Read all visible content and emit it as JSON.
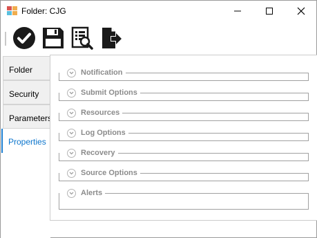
{
  "window": {
    "title": "Folder: CJG",
    "controls": [
      "minimize-icon",
      "maximize-icon",
      "close-icon"
    ]
  },
  "toolbar": {
    "buttons": [
      {
        "name": "ok",
        "icon": "check-circle-icon"
      },
      {
        "name": "save",
        "icon": "floppy-disk-icon"
      },
      {
        "name": "preview",
        "icon": "document-search-icon"
      },
      {
        "name": "export",
        "icon": "document-export-icon"
      }
    ]
  },
  "tabs": [
    {
      "label": "Folder",
      "active": false
    },
    {
      "label": "Security",
      "active": false
    },
    {
      "label": "Parameters",
      "active": false
    },
    {
      "label": "Properties",
      "active": true
    }
  ],
  "sections": [
    {
      "label": "Notification"
    },
    {
      "label": "Submit Options"
    },
    {
      "label": "Resources"
    },
    {
      "label": "Log Options"
    },
    {
      "label": "Recovery"
    },
    {
      "label": "Source Options"
    },
    {
      "label": "Alerts"
    }
  ],
  "colors": {
    "active_tab_text": "#0a74cc",
    "section_label": "#8c8c8c",
    "icon_dark": "#1a1a1a"
  }
}
